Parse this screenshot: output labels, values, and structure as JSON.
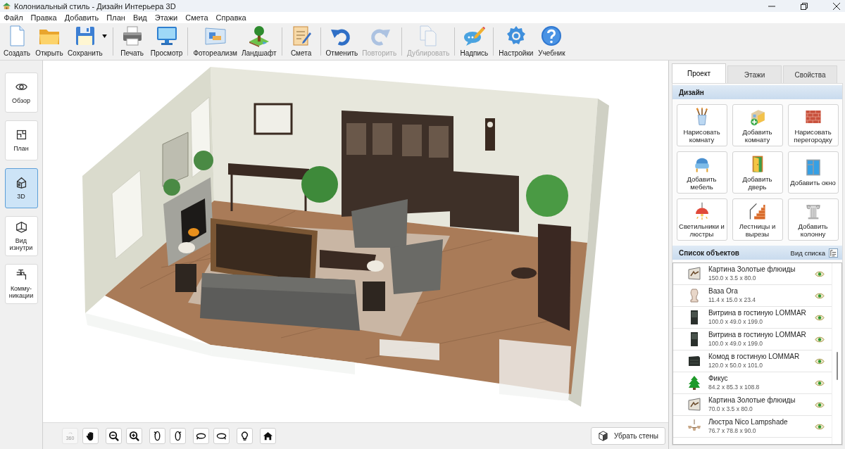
{
  "window": {
    "title": "Колониальный стиль - Дизайн Интерьера 3D"
  },
  "menu": [
    "Файл",
    "Правка",
    "Добавить",
    "План",
    "Вид",
    "Этажи",
    "Смета",
    "Справка"
  ],
  "toolbar": [
    {
      "items": [
        {
          "kind": "new",
          "label": "Создать",
          "disabled": false,
          "has_menu": false
        },
        {
          "kind": "open",
          "label": "Открыть",
          "disabled": false,
          "has_menu": false
        },
        {
          "kind": "save",
          "label": "Сохранить",
          "disabled": false,
          "has_menu": true
        }
      ]
    },
    {
      "items": [
        {
          "kind": "print",
          "label": "Печать",
          "disabled": false,
          "has_menu": false
        },
        {
          "kind": "preview",
          "label": "Просмотр",
          "disabled": false,
          "has_menu": false
        }
      ]
    },
    {
      "items": [
        {
          "kind": "photoreal",
          "label": "Фотореализм",
          "disabled": false,
          "has_menu": false
        },
        {
          "kind": "landscape",
          "label": "Ландшафт",
          "disabled": false,
          "has_menu": false
        }
      ]
    },
    {
      "items": [
        {
          "kind": "estimate",
          "label": "Смета",
          "disabled": false,
          "has_menu": false
        }
      ]
    },
    {
      "items": [
        {
          "kind": "undo",
          "label": "Отменить",
          "disabled": false,
          "has_menu": false
        },
        {
          "kind": "redo",
          "label": "Повторить",
          "disabled": true,
          "has_menu": false
        }
      ]
    },
    {
      "items": [
        {
          "kind": "duplicate",
          "label": "Дублировать",
          "disabled": true,
          "has_menu": false
        }
      ]
    },
    {
      "items": [
        {
          "kind": "caption",
          "label": "Надпись",
          "disabled": false,
          "has_menu": false
        }
      ]
    },
    {
      "items": [
        {
          "kind": "settings",
          "label": "Настройки",
          "disabled": false,
          "has_menu": false
        },
        {
          "kind": "help",
          "label": "Учебник",
          "disabled": false,
          "has_menu": false
        }
      ]
    }
  ],
  "view_modes": [
    {
      "kind": "overview",
      "label": "Обзор",
      "selected": false
    },
    {
      "kind": "plan",
      "label": "План",
      "selected": false
    },
    {
      "kind": "perspective",
      "label": "3D",
      "selected": true
    },
    {
      "kind": "inside",
      "label": "Вид изнутри",
      "selected": false
    },
    {
      "kind": "utilities",
      "label": "Комму-\nникации",
      "selected": false
    }
  ],
  "viewport": {
    "view_tools": [
      {
        "tools": [
          {
            "kind": "orbit-360",
            "label": "360",
            "disabled": true
          },
          {
            "kind": "pan",
            "disabled": false
          }
        ]
      },
      {
        "tools": [
          {
            "kind": "zoom-out",
            "disabled": false
          },
          {
            "kind": "zoom-in",
            "disabled": false
          }
        ]
      },
      {
        "tools": [
          {
            "kind": "tilt-left",
            "disabled": false
          },
          {
            "kind": "tilt-right",
            "disabled": false
          }
        ]
      },
      {
        "tools": [
          {
            "kind": "orbit-left",
            "disabled": false
          },
          {
            "kind": "orbit-right",
            "disabled": false
          }
        ]
      },
      {
        "tools": [
          {
            "kind": "light",
            "disabled": false
          }
        ]
      },
      {
        "tools": [
          {
            "kind": "home",
            "disabled": false
          }
        ]
      }
    ],
    "remove_walls_button": "Убрать стены"
  },
  "right_panel": {
    "tabs": [
      {
        "label": "Проект",
        "selected": true
      },
      {
        "label": "Этажи",
        "selected": false
      },
      {
        "label": "Свойства",
        "selected": false
      }
    ],
    "design": {
      "title": "Дизайн",
      "buttons": [
        {
          "kind": "draw-room",
          "label": "Нарисовать комнату"
        },
        {
          "kind": "add-room",
          "label": "Добавить комнату"
        },
        {
          "kind": "draw-wall",
          "label": "Нарисовать перегородку"
        },
        {
          "kind": "furniture",
          "label": "Добавить мебель"
        },
        {
          "kind": "door",
          "label": "Добавить дверь"
        },
        {
          "kind": "window",
          "label": "Добавить окно"
        },
        {
          "kind": "lights",
          "label": "Светильники и люстры"
        },
        {
          "kind": "stairs",
          "label": "Лестницы и вырезы"
        },
        {
          "kind": "column",
          "label": "Добавить колонну"
        }
      ]
    },
    "objects": {
      "title": "Список объектов",
      "view_label": "Вид списка",
      "items": [
        {
          "kind": "painting",
          "name": "Картина Золотые флюиды",
          "size": "150.0 x 3.5 x 80.0",
          "visible": true
        },
        {
          "kind": "vase",
          "name": "Ваза Ora",
          "size": "11.4 x 15.0 x 23.4",
          "visible": true
        },
        {
          "kind": "cabinet",
          "name": "Витрина в гостиную LOMMAR",
          "size": "100.0 x 49.0 x 199.0",
          "visible": true
        },
        {
          "kind": "cabinet",
          "name": "Витрина в гостиную LOMMAR",
          "size": "100.0 x 49.0 x 199.0",
          "visible": true
        },
        {
          "kind": "dresser",
          "name": "Комод в гостиную LOMMAR",
          "size": "120.0 x 50.0 x 101.0",
          "visible": true
        },
        {
          "kind": "plant",
          "name": "Фикус",
          "size": "84.2 x 85.3 x 108.8",
          "visible": true
        },
        {
          "kind": "painting",
          "name": "Картина Золотые флюиды",
          "size": "70.0 x 3.5 x 80.0",
          "visible": true
        },
        {
          "kind": "chandelier",
          "name": "Люстра Nico Lampshade",
          "size": "76.7 x 78.8 x 90.0",
          "visible": true
        }
      ]
    }
  }
}
